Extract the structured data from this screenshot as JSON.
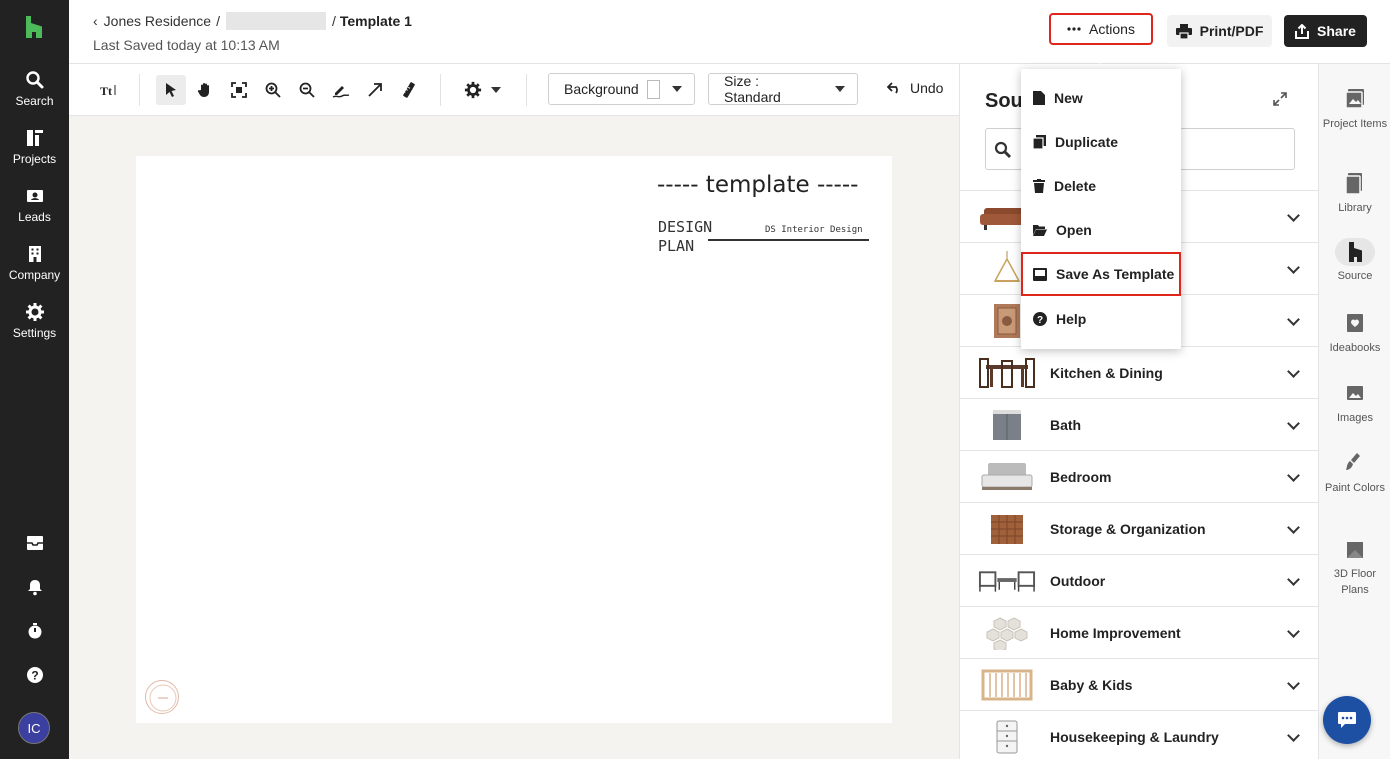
{
  "nav": {
    "items": [
      {
        "label": "Search",
        "icon": "search-icon"
      },
      {
        "label": "Projects",
        "icon": "projects-icon"
      },
      {
        "label": "Leads",
        "icon": "leads-icon"
      },
      {
        "label": "Company",
        "icon": "company-icon"
      },
      {
        "label": "Settings",
        "icon": "gear-icon"
      }
    ],
    "avatar_initials": "IC"
  },
  "header": {
    "breadcrumb_project": "Jones Residence",
    "breadcrumb_sep": "/",
    "breadcrumb_current": "Template 1",
    "last_saved": "Last Saved today at 10:13 AM",
    "actions_label": "Actions",
    "print_label": "Print/PDF",
    "share_label": "Share"
  },
  "toolbar": {
    "background_label": "Background",
    "background_color": "#ffffff",
    "size_label": "Size : Standard",
    "undo_label": "Undo"
  },
  "canvas": {
    "template_title": "----- template -----",
    "design_plan": "DESIGN PLAN",
    "studio_name": "DS Interior Design"
  },
  "source": {
    "title": "Sour",
    "categories": [
      {
        "label": ""
      },
      {
        "label": ""
      },
      {
        "label": ""
      },
      {
        "label": "Kitchen & Dining"
      },
      {
        "label": "Bath"
      },
      {
        "label": "Bedroom"
      },
      {
        "label": "Storage & Organization"
      },
      {
        "label": "Outdoor"
      },
      {
        "label": "Home Improvement"
      },
      {
        "label": "Baby & Kids"
      },
      {
        "label": "Housekeeping & Laundry"
      }
    ]
  },
  "rail": {
    "items": [
      {
        "label": "Project Items"
      },
      {
        "label": "Library"
      },
      {
        "label": "Source"
      },
      {
        "label": "Ideabooks"
      },
      {
        "label": "Images"
      },
      {
        "label": "Paint Colors"
      },
      {
        "label": "3D Floor Plans"
      }
    ]
  },
  "menu": {
    "items": [
      {
        "label": "New"
      },
      {
        "label": "Duplicate"
      },
      {
        "label": "Delete"
      },
      {
        "label": "Open"
      },
      {
        "label": "Save As Template"
      },
      {
        "label": "Help"
      }
    ]
  },
  "colors": {
    "accent_red": "#e0251b",
    "brand_green": "#4dbb5a",
    "chat_blue": "#1d4fa3"
  }
}
